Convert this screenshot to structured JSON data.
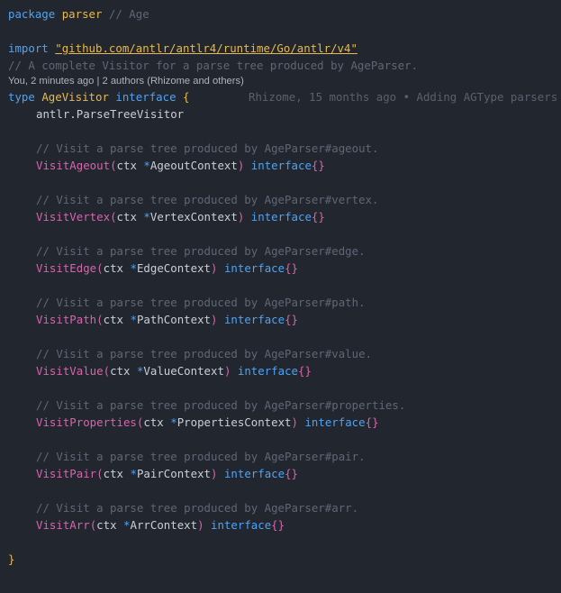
{
  "editor": {
    "lines": {
      "package_kw": "package",
      "package_name": "parser",
      "package_comment": "// Age",
      "import_kw": "import",
      "import_path": "\"github.com/antlr/antlr4/runtime/Go/antlr/v4\"",
      "doc_comment": "// A complete Visitor for a parse tree produced by AgeParser.",
      "codelens": "You, 2 minutes ago | 2 authors (Rhizome and others)",
      "type_kw": "type",
      "type_name": "AgeVisitor",
      "interface_kw": "interface",
      "open_brace": "{",
      "blame": "Rhizome, 15 months ago • Adding AGType parsers",
      "embedded": "antlr.ParseTreeVisitor",
      "close_brace": "}"
    },
    "methods": [
      {
        "comment": "// Visit a parse tree produced by AgeParser#ageout.",
        "name": "VisitAgeout",
        "ctx": "ctx",
        "ptr": "*",
        "ctx_type": "AgeoutContext",
        "ret": "interface",
        "ret_braces": "{}"
      },
      {
        "comment": "// Visit a parse tree produced by AgeParser#vertex.",
        "name": "VisitVertex",
        "ctx": "ctx",
        "ptr": "*",
        "ctx_type": "VertexContext",
        "ret": "interface",
        "ret_braces": "{}"
      },
      {
        "comment": "// Visit a parse tree produced by AgeParser#edge.",
        "name": "VisitEdge",
        "ctx": "ctx",
        "ptr": "*",
        "ctx_type": "EdgeContext",
        "ret": "interface",
        "ret_braces": "{}"
      },
      {
        "comment": "// Visit a parse tree produced by AgeParser#path.",
        "name": "VisitPath",
        "ctx": "ctx",
        "ptr": "*",
        "ctx_type": "PathContext",
        "ret": "interface",
        "ret_braces": "{}"
      },
      {
        "comment": "// Visit a parse tree produced by AgeParser#value.",
        "name": "VisitValue",
        "ctx": "ctx",
        "ptr": "*",
        "ctx_type": "ValueContext",
        "ret": "interface",
        "ret_braces": "{}"
      },
      {
        "comment": "// Visit a parse tree produced by AgeParser#properties.",
        "name": "VisitProperties",
        "ctx": "ctx",
        "ptr": "*",
        "ctx_type": "PropertiesContext",
        "ret": "interface",
        "ret_braces": "{}"
      },
      {
        "comment": "// Visit a parse tree produced by AgeParser#pair.",
        "name": "VisitPair",
        "ctx": "ctx",
        "ptr": "*",
        "ctx_type": "PairContext",
        "ret": "interface",
        "ret_braces": "{}"
      },
      {
        "comment": "// Visit a parse tree produced by AgeParser#arr.",
        "name": "VisitArr",
        "ctx": "ctx",
        "ptr": "*",
        "ctx_type": "ArrContext",
        "ret": "interface",
        "ret_braces": "{}"
      }
    ]
  },
  "colors": {
    "background": "#22262e",
    "keyword": "#4fa3f4",
    "identifier_yellow": "#e8b94c",
    "function_pink": "#d864ad",
    "comment": "#5f6776",
    "text": "#c9cfd8"
  }
}
